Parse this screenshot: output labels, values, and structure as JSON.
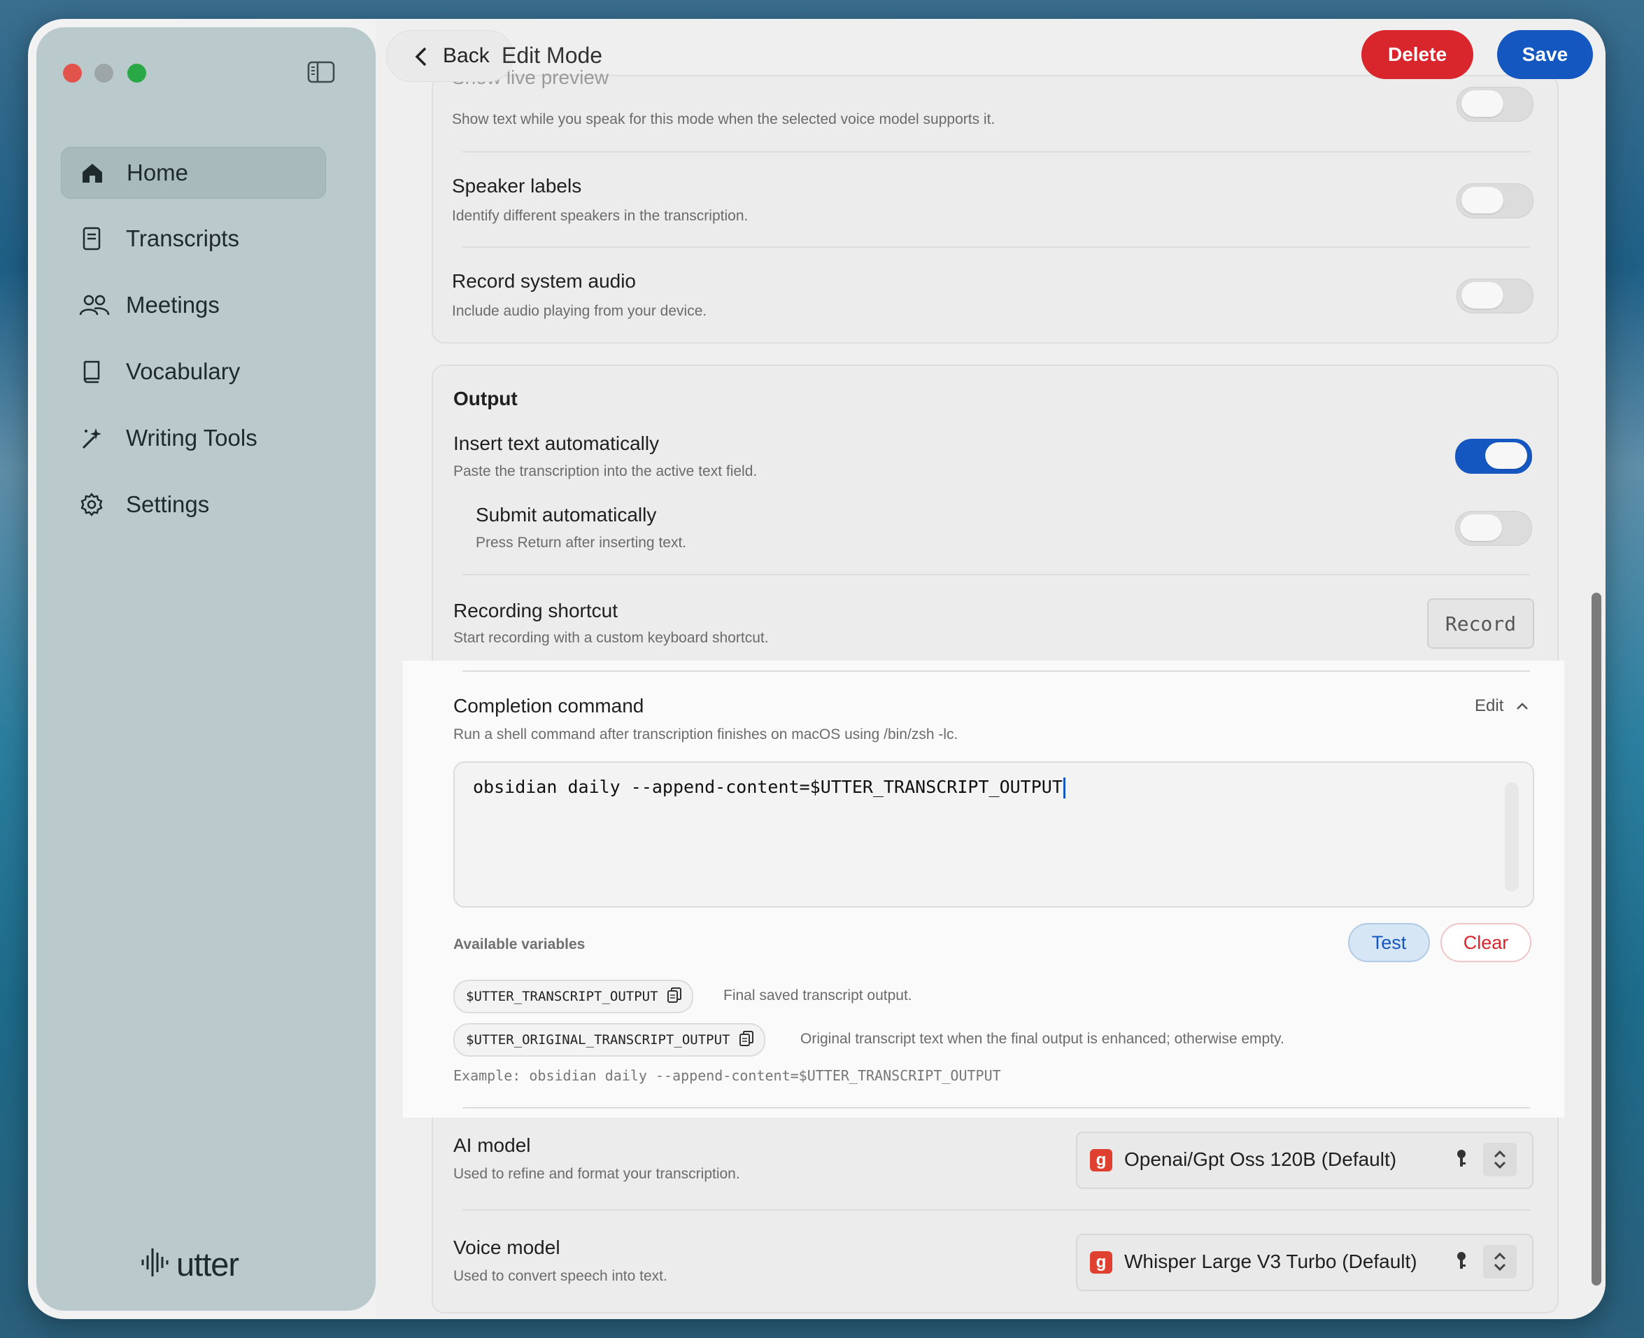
{
  "sidebar": {
    "items": [
      {
        "label": "Home",
        "icon": "home-icon"
      },
      {
        "label": "Transcripts",
        "icon": "document-icon"
      },
      {
        "label": "Meetings",
        "icon": "people-icon"
      },
      {
        "label": "Vocabulary",
        "icon": "book-icon"
      },
      {
        "label": "Writing Tools",
        "icon": "sparkle-wand-icon"
      },
      {
        "label": "Settings",
        "icon": "gear-icon"
      }
    ],
    "active_index": 0,
    "logo_text": "utter"
  },
  "header": {
    "back_label": "Back",
    "title": "Edit Mode",
    "delete_label": "Delete",
    "save_label": "Save"
  },
  "settings_top": {
    "live_preview": {
      "title": "Show live preview",
      "desc": "Show text while you speak for this mode when the selected voice model supports it.",
      "enabled": false
    },
    "speaker_labels": {
      "title": "Speaker labels",
      "desc": "Identify different speakers in the transcription.",
      "enabled": false
    },
    "record_system_audio": {
      "title": "Record system audio",
      "desc": "Include audio playing from your device.",
      "enabled": false
    }
  },
  "output": {
    "heading": "Output",
    "insert_text": {
      "title": "Insert text automatically",
      "desc": "Paste the transcription into the active text field.",
      "enabled": true
    },
    "submit_auto": {
      "title": "Submit automatically",
      "desc": "Press Return after inserting text.",
      "enabled": false
    },
    "recording_shortcut": {
      "title": "Recording shortcut",
      "desc": "Start recording with a custom keyboard shortcut.",
      "button": "Record"
    },
    "completion": {
      "title": "Completion command",
      "desc": "Run a shell command after transcription finishes on macOS using /bin/zsh -lc.",
      "edit_label": "Edit",
      "command": "obsidian daily --append-content=$UTTER_TRANSCRIPT_OUTPUT",
      "vars_label": "Available variables",
      "test_label": "Test",
      "clear_label": "Clear",
      "variables": [
        {
          "name": "$UTTER_TRANSCRIPT_OUTPUT",
          "desc": "Final saved transcript output."
        },
        {
          "name": "$UTTER_ORIGINAL_TRANSCRIPT_OUTPUT",
          "desc": "Original transcript text when the final output is enhanced; otherwise empty."
        }
      ],
      "example": "Example: obsidian daily --append-content=$UTTER_TRANSCRIPT_OUTPUT"
    },
    "ai_model": {
      "title": "AI model",
      "desc": "Used to refine and format your transcription.",
      "value": "Openai/Gpt Oss 120B (Default)",
      "provider_badge": "g"
    },
    "voice_model": {
      "title": "Voice model",
      "desc": "Used to convert speech into text.",
      "value": "Whisper Large V3 Turbo (Default)",
      "provider_badge": "g"
    }
  },
  "colors": {
    "accent": "#1557c0",
    "danger": "#d9262d",
    "provider_badge": "#e0402f"
  }
}
